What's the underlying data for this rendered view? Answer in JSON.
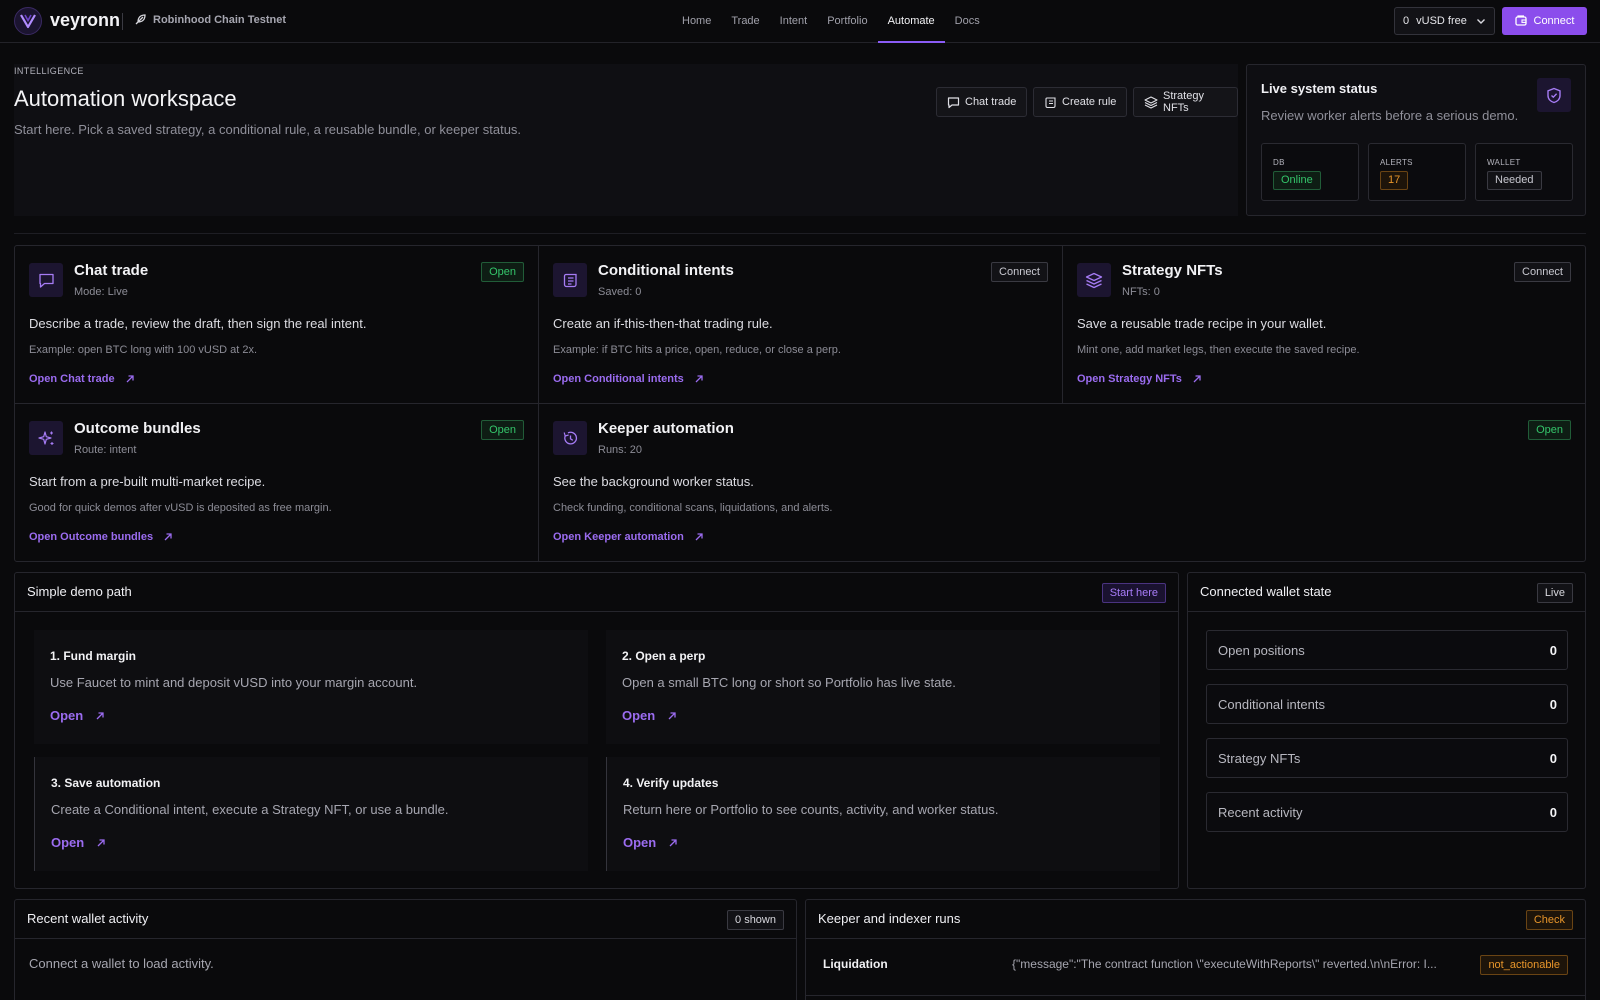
{
  "header": {
    "brand": "veyronn",
    "network": "Robinhood Chain Testnet",
    "nav": [
      "Home",
      "Trade",
      "Intent",
      "Portfolio",
      "Automate",
      "Docs"
    ],
    "active_nav": "Automate",
    "balance": {
      "amount": "0",
      "unit": "vUSD free"
    },
    "connect_label": "Connect"
  },
  "hero": {
    "eyebrow": "INTELLIGENCE",
    "title": "Automation workspace",
    "subtitle": "Start here. Pick a saved strategy, a conditional rule, a reusable bundle, or keeper status.",
    "buttons": [
      "Chat trade",
      "Create rule",
      "Strategy NFTs"
    ]
  },
  "status": {
    "title": "Live system status",
    "subtitle": "Review worker alerts before a serious demo.",
    "stats": [
      {
        "label": "DB",
        "value": "Online",
        "color": "#34c46a"
      },
      {
        "label": "ALERTS",
        "value": "17",
        "color": "#e8952a"
      },
      {
        "label": "WALLET",
        "value": "Needed",
        "color": "#c8c8d0"
      }
    ]
  },
  "features": [
    {
      "title": "Chat trade",
      "meta": "Mode: Live",
      "badge": "Open",
      "desc": "Describe a trade, review the draft, then sign the real intent.",
      "example": "Example: open BTC long with 100 vUSD at 2x.",
      "link": "Open Chat trade",
      "icon": "chat-icon"
    },
    {
      "title": "Conditional intents",
      "meta": "Saved: 0",
      "badge": "Connect",
      "desc": "Create an if-this-then-that trading rule.",
      "example": "Example: if BTC hits a price, open, reduce, or close a perp.",
      "link": "Open Conditional intents",
      "icon": "scroll-icon"
    },
    {
      "title": "Strategy NFTs",
      "meta": "NFTs: 0",
      "badge": "Connect",
      "desc": "Save a reusable trade recipe in your wallet.",
      "example": "Mint one, add market legs, then execute the saved recipe.",
      "link": "Open Strategy NFTs",
      "icon": "layers-icon"
    },
    {
      "title": "Outcome bundles",
      "meta": "Route: intent",
      "badge": "Open",
      "desc": "Start from a pre-built multi-market recipe.",
      "example": "Good for quick demos after vUSD is deposited as free margin.",
      "link": "Open Outcome bundles",
      "icon": "sparkles-icon"
    },
    {
      "title": "Keeper automation",
      "meta": "Runs: 20",
      "badge": "Open",
      "desc": "See the background worker status.",
      "example": "Check funding, conditional scans, liquidations, and alerts.",
      "link": "Open Keeper automation",
      "icon": "timer-icon"
    }
  ],
  "demo": {
    "title": "Simple demo path",
    "badge": "Start here",
    "steps": [
      {
        "title": "1. Fund margin",
        "desc": "Use Faucet to mint and deposit vUSD into your margin account.",
        "link": "Open"
      },
      {
        "title": "2. Open a perp",
        "desc": "Open a small BTC long or short so Portfolio has live state.",
        "link": "Open"
      },
      {
        "title": "3. Save automation",
        "desc": "Create a Conditional intent, execute a Strategy NFT, or use a bundle.",
        "link": "Open"
      },
      {
        "title": "4. Verify updates",
        "desc": "Return here or Portfolio to see counts, activity, and worker status.",
        "link": "Open"
      }
    ]
  },
  "wallet_state": {
    "title": "Connected wallet state",
    "badge": "Live",
    "rows": [
      {
        "label": "Open positions",
        "value": "0"
      },
      {
        "label": "Conditional intents",
        "value": "0"
      },
      {
        "label": "Strategy NFTs",
        "value": "0"
      },
      {
        "label": "Recent activity",
        "value": "0"
      }
    ]
  },
  "activity": {
    "title": "Recent wallet activity",
    "badge": "0 shown",
    "empty": "Connect a wallet to load activity."
  },
  "runs": {
    "title": "Keeper and indexer runs",
    "badge": "Check",
    "rows": [
      {
        "name": "Liquidation",
        "message": "{\"message\":\"The contract function \\\"executeWithReports\\\" reverted.\\n\\nError: I...",
        "status": "not_actionable"
      }
    ]
  }
}
